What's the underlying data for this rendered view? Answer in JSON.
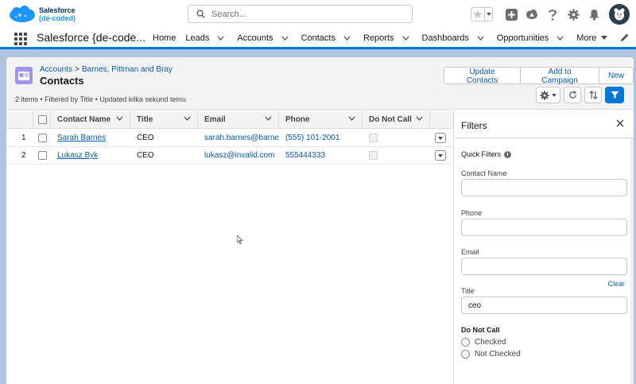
{
  "brand": {
    "line1": "Salesforce",
    "line2": "(de-coded)"
  },
  "search": {
    "placeholder": "Search..."
  },
  "nav": {
    "app_name": "Salesforce {de-code...",
    "items": [
      {
        "label": "Home",
        "dropdown": false
      },
      {
        "label": "Leads",
        "dropdown": true
      },
      {
        "label": "Accounts",
        "dropdown": true
      },
      {
        "label": "Contacts",
        "dropdown": true
      },
      {
        "label": "Reports",
        "dropdown": true
      },
      {
        "label": "Dashboards",
        "dropdown": true
      },
      {
        "label": "Opportunities",
        "dropdown": true
      },
      {
        "label": "More",
        "dropdown": true
      }
    ]
  },
  "page": {
    "breadcrumb_parent": "Accounts",
    "breadcrumb_sep": ">",
    "breadcrumb_current": "Barnes, Pittman and Bray",
    "title": "Contacts",
    "meta": "2 items • Filtered by Title • Updated kilka sekund temu",
    "buttons": {
      "update": "Update Contacts",
      "campaign": "Add to Campaign",
      "new": "New"
    }
  },
  "table": {
    "columns": [
      "Contact Name",
      "Title",
      "Email",
      "Phone",
      "Do Not Call"
    ],
    "rows": [
      {
        "num": "1",
        "name": "Sarah Barnes",
        "title": "CEO",
        "email": "sarah.barnes@barne...",
        "phone": "(555) 101-2001"
      },
      {
        "num": "2",
        "name": "Lukasz Byk",
        "title": "CEO",
        "email": "lukasz@invalid.com",
        "phone": "555444333"
      }
    ]
  },
  "filters": {
    "title": "Filters",
    "quick": "Quick Filters",
    "info": "i",
    "contact_name_label": "Contact Name",
    "phone_label": "Phone",
    "email_label": "Email",
    "clear": "Clear",
    "title_label": "Title",
    "title_value": "ceo",
    "dnc_label": "Do Not Call",
    "opt_checked": "Checked",
    "opt_not_checked": "Not Checked"
  },
  "colors": {
    "accent": "#0176d3",
    "link": "#0b5cab",
    "contact_icon": "#a094ed",
    "background": "#b0c4df"
  }
}
